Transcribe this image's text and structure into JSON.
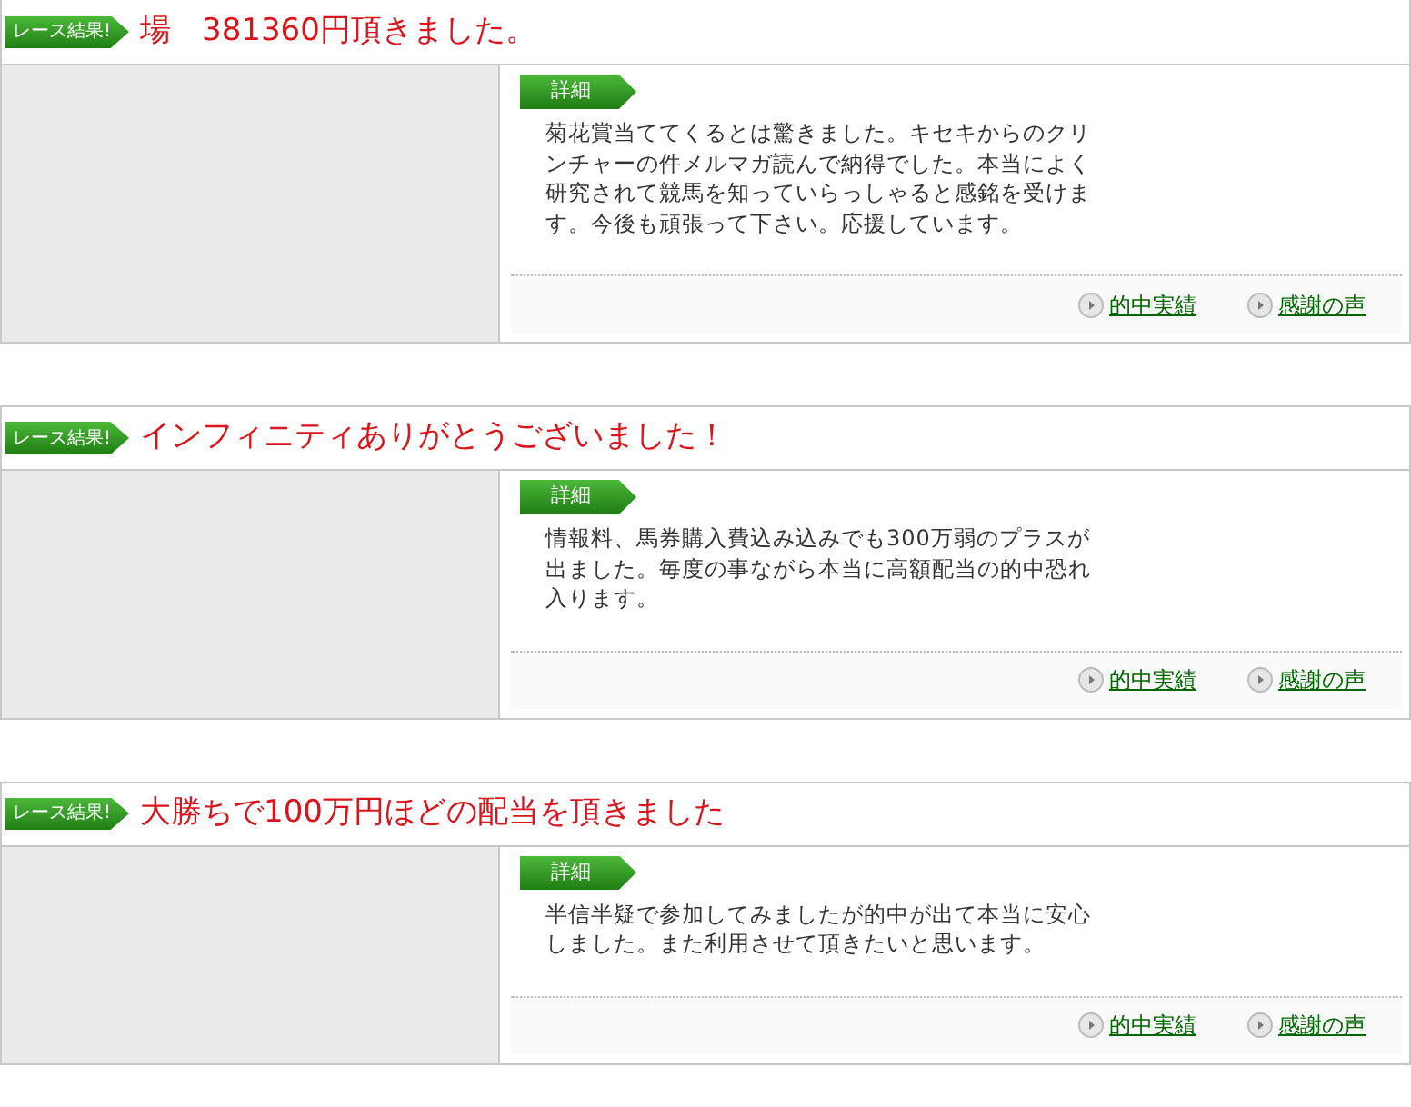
{
  "entries": [
    {
      "badge": "レース結果!",
      "title": "場　381360円頂きました。",
      "detail_label": "詳細",
      "comment": "菊花賞当ててくるとは驚きました。キセキからのクリンチャーの件メルマガ読んで納得でした。本当によく研究されて競馬を知っていらっしゃると感銘を受けます。今後も頑張って下さい。応援しています。",
      "links": [
        "的中実績",
        "感謝の声"
      ]
    },
    {
      "badge": "レース結果!",
      "title": "インフィニティありがとうございました！",
      "detail_label": "詳細",
      "comment": "情報料、馬券購入費込み込みでも300万弱のプラスが出ました。毎度の事ながら本当に高額配当の的中恐れ入ります。",
      "links": [
        "的中実績",
        "感謝の声"
      ]
    },
    {
      "badge": "レース結果!",
      "title": "大勝ちで100万円ほどの配当を頂きました",
      "detail_label": "詳細",
      "comment": "半信半疑で参加してみましたが的中が出て本当に安心しました。また利用させて頂きたいと思います。",
      "links": [
        "的中実績",
        "感謝の声"
      ]
    }
  ]
}
